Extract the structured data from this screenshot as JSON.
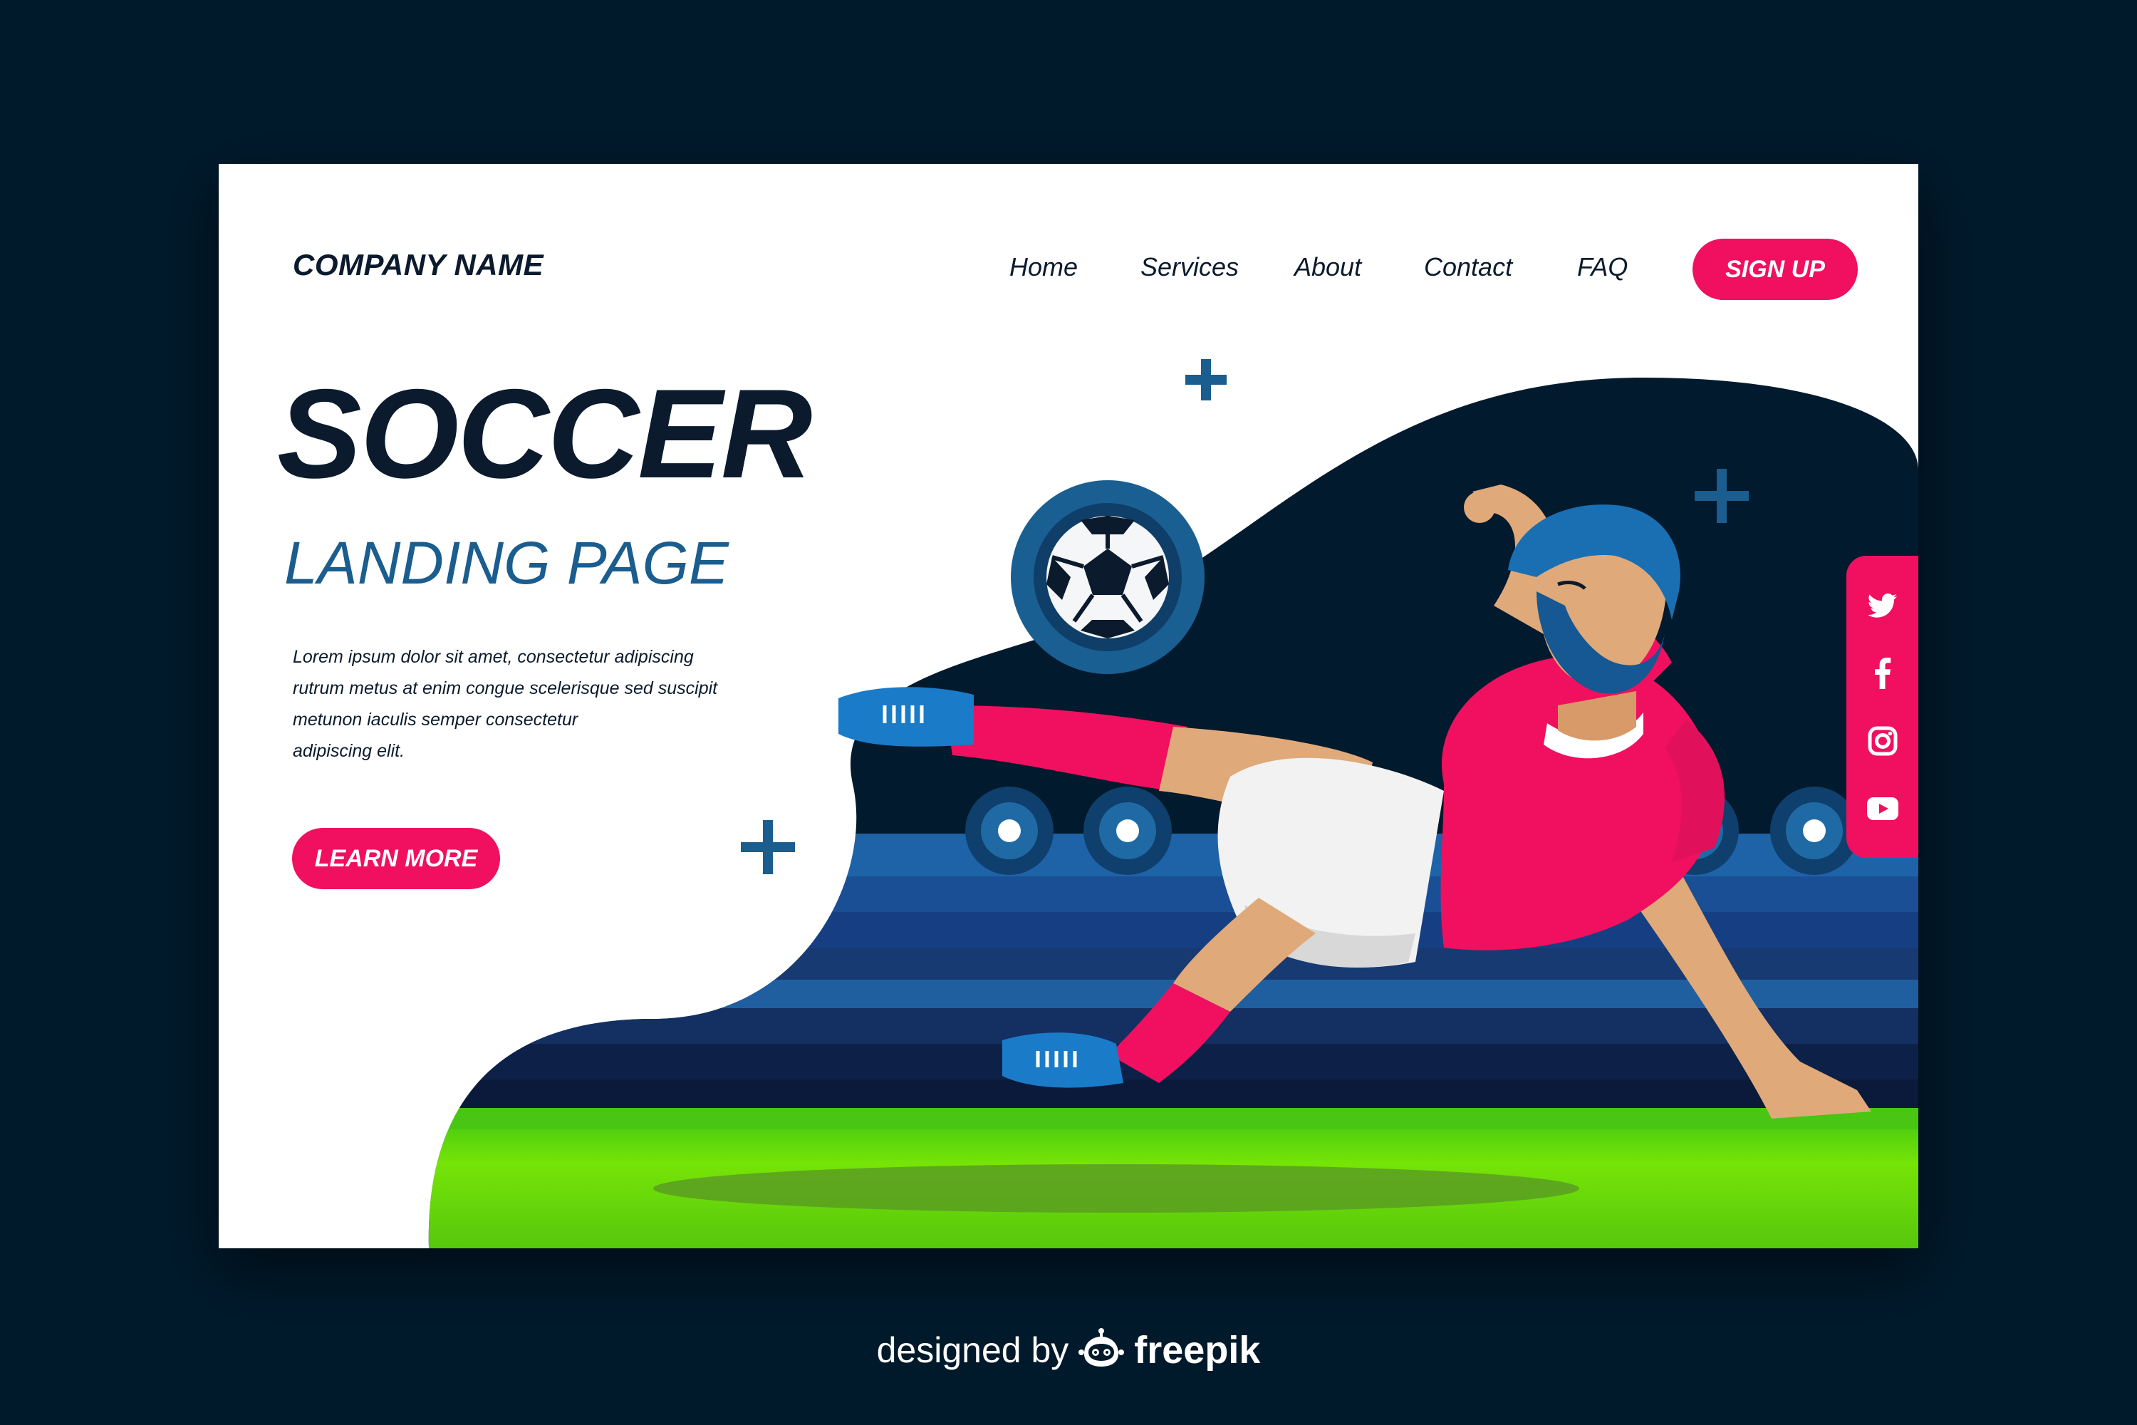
{
  "header": {
    "company_name": "COMPANY NAME",
    "nav": [
      "Home",
      "Services",
      "About",
      "Contact",
      "FAQ"
    ],
    "signup_label": "SIGN UP"
  },
  "hero": {
    "title": "SOCCER",
    "subtitle": "LANDING PAGE",
    "body_lines": [
      "Lorem ipsum dolor sit amet, consectetur adipiscing",
      "rutrum metus at enim congue scelerisque sed suscipit",
      "metunon iaculis semper consectetur",
      "adipiscing elit."
    ],
    "cta_label": "LEARN MORE"
  },
  "social": {
    "icons": [
      "twitter-icon",
      "facebook-icon",
      "instagram-icon",
      "youtube-icon"
    ]
  },
  "footer": {
    "designed_by": "designed by",
    "brand": "freepik"
  },
  "colors": {
    "background": "#001a2c",
    "accent": "#f0105f",
    "navy": "#0b1b2d",
    "blue": "#1a5d8e",
    "grass": "#5fd50f"
  }
}
